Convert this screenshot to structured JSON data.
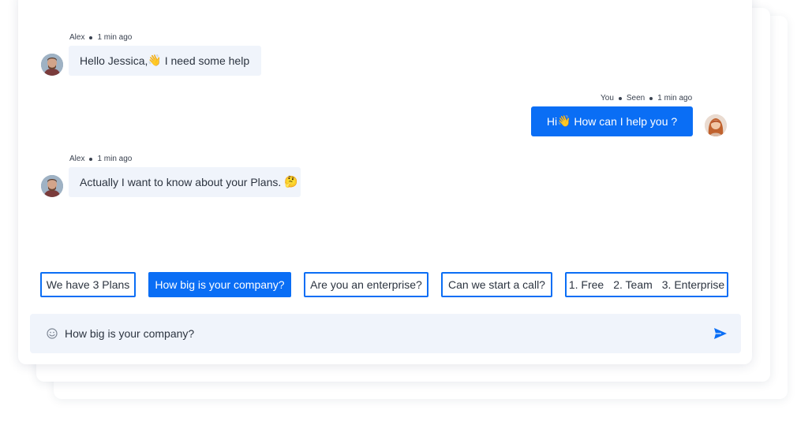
{
  "messages": [
    {
      "sender": "Alex",
      "time": "1 min ago",
      "text_before": "Hello Jessica, ",
      "emoji": "👋",
      "text_after": " I need some help"
    },
    {
      "sender": "You",
      "status": "Seen",
      "time": "1 min ago",
      "text_before": "Hi",
      "emoji": "👋",
      "text_after": " How can I help you ?"
    },
    {
      "sender": "Alex",
      "time": "1 min ago",
      "text_before": "Actually I want to know about your Plans. ",
      "emoji": "🤔",
      "text_after": ""
    }
  ],
  "quick_replies": [
    {
      "label": "We have 3 Plans",
      "active": false
    },
    {
      "label": "How big is your company?",
      "active": true
    },
    {
      "label": "Are you an enterprise?",
      "active": false
    },
    {
      "label": "Can we start a call?",
      "active": false
    },
    {
      "parts": [
        "1. Free",
        "2. Team",
        "3. Enterprise"
      ],
      "active": false
    }
  ],
  "composer": {
    "value": "How big is your company?",
    "emoji_icon": "smile-icon",
    "send_icon": "send-icon"
  },
  "colors": {
    "accent": "#0a6ef5",
    "bubble_in": "#f0f4fb",
    "composer_bg": "#f0f4fb",
    "text": "#2c3440"
  }
}
